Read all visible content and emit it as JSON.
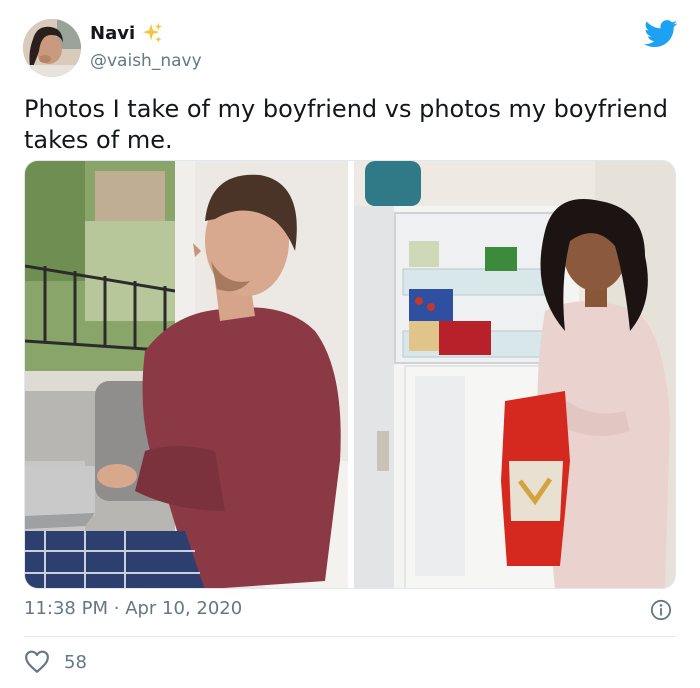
{
  "user": {
    "name": "Navi",
    "handle": "@vaish_navy",
    "name_emoji": "sparkles-icon"
  },
  "tweet": {
    "text": "Photos I take of my boyfriend vs photos my boyfriend takes of me.",
    "time": "11:38 PM",
    "separator": "·",
    "date": "Apr 10, 2020",
    "likes": "58"
  },
  "media": {
    "left_photo": "man on couch with laptop",
    "right_photo": "woman at open refrigerator holding bread bag"
  },
  "colors": {
    "brand": "#1da1f2",
    "text_primary": "#14171a",
    "text_secondary": "#657786",
    "border": "#e1e8ed"
  },
  "icons": [
    "twitter-bird-icon",
    "info-icon",
    "heart-icon",
    "sparkles-icon"
  ]
}
